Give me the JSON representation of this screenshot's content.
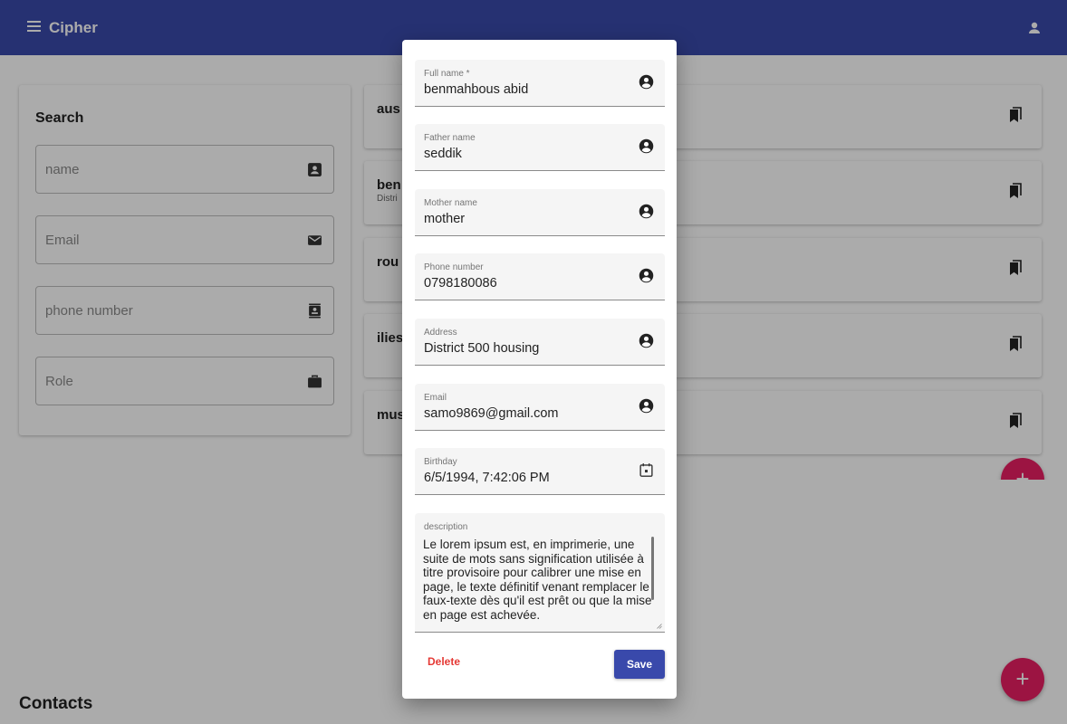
{
  "app": {
    "title": "Cipher"
  },
  "search": {
    "title": "Search",
    "fields": [
      {
        "placeholder": "name",
        "icon": "contact-card-icon"
      },
      {
        "placeholder": "Email",
        "icon": "envelope-icon"
      },
      {
        "placeholder": "phone number",
        "icon": "phone-book-icon"
      },
      {
        "placeholder": "Role",
        "icon": "briefcase-icon"
      }
    ]
  },
  "contacts": {
    "heading": "Contacts",
    "items": [
      {
        "name": "aus",
        "subtitle": ""
      },
      {
        "name": "ben",
        "subtitle": "Distri"
      },
      {
        "name": "rou",
        "subtitle": ""
      },
      {
        "name": "ilies",
        "subtitle": ""
      },
      {
        "name": "mus",
        "subtitle": ""
      }
    ]
  },
  "dialog": {
    "fields": [
      {
        "label": "Full name *",
        "value": "benmahbous abid",
        "icon": "account-circle-icon"
      },
      {
        "label": "Father name",
        "value": "seddik",
        "icon": "account-circle-icon"
      },
      {
        "label": "Mother name",
        "value": "mother",
        "icon": "account-circle-icon"
      },
      {
        "label": "Phone number",
        "value": "0798180086",
        "icon": "account-circle-icon"
      },
      {
        "label": "Address",
        "value": "District 500 housing",
        "icon": "account-circle-icon"
      },
      {
        "label": "Email",
        "value": "samo9869@gmail.com",
        "icon": "account-circle-icon"
      },
      {
        "label": "Birthday",
        "value": "6/5/1994, 7:42:06 PM",
        "icon": "calendar-icon"
      }
    ],
    "description": {
      "label": "description",
      "value": "Le lorem ipsum est, en imprimerie, une suite de mots sans signification utilisée à titre provisoire pour calibrer une mise en page, le texte définitif venant remplacer le faux-texte dès qu'il est prêt ou que la mise en page est achevée."
    },
    "delete_label": "Delete",
    "save_label": "Save"
  },
  "colors": {
    "primary": "#3949ab",
    "accent": "#e91e63",
    "danger": "#e53935"
  }
}
